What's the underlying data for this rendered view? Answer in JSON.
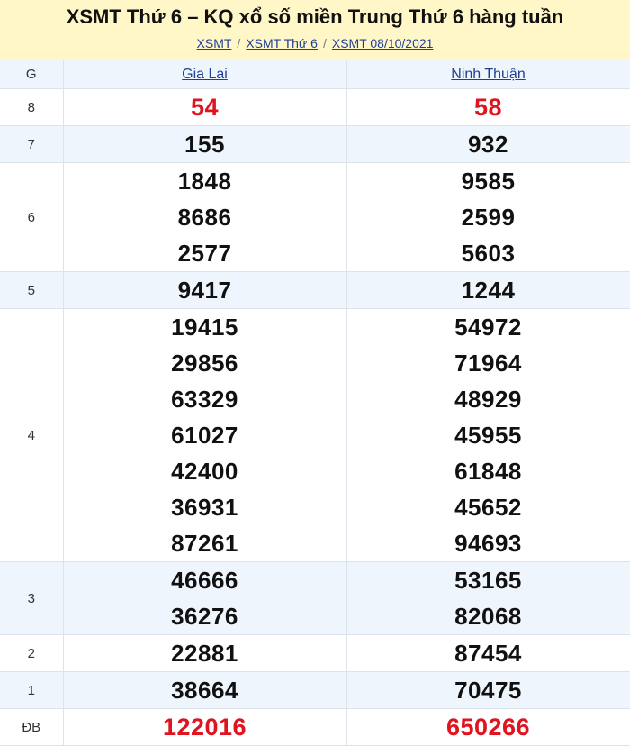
{
  "header": {
    "title": "XSMT Thứ 6 – KQ xổ số miền Trung Thứ 6 hàng tuần",
    "breadcrumb": [
      "XSMT",
      "XSMT Thứ 6",
      "XSMT 08/10/2021"
    ],
    "separator": "/"
  },
  "table": {
    "prize_col_label": "G",
    "provinces": [
      "Gia Lai",
      "Ninh Thuận"
    ],
    "rows": [
      {
        "prize": "8",
        "highlight": true,
        "alt": false,
        "results": [
          [
            "54"
          ],
          [
            "58"
          ]
        ]
      },
      {
        "prize": "7",
        "highlight": false,
        "alt": true,
        "results": [
          [
            "155"
          ],
          [
            "932"
          ]
        ]
      },
      {
        "prize": "6",
        "highlight": false,
        "alt": false,
        "results": [
          [
            "1848",
            "8686",
            "2577"
          ],
          [
            "9585",
            "2599",
            "5603"
          ]
        ]
      },
      {
        "prize": "5",
        "highlight": false,
        "alt": true,
        "results": [
          [
            "9417"
          ],
          [
            "1244"
          ]
        ]
      },
      {
        "prize": "4",
        "highlight": false,
        "alt": false,
        "results": [
          [
            "19415",
            "29856",
            "63329",
            "61027",
            "42400",
            "36931",
            "87261"
          ],
          [
            "54972",
            "71964",
            "48929",
            "45955",
            "61848",
            "45652",
            "94693"
          ]
        ]
      },
      {
        "prize": "3",
        "highlight": false,
        "alt": true,
        "results": [
          [
            "46666",
            "36276"
          ],
          [
            "53165",
            "82068"
          ]
        ]
      },
      {
        "prize": "2",
        "highlight": false,
        "alt": false,
        "results": [
          [
            "22881"
          ],
          [
            "87454"
          ]
        ]
      },
      {
        "prize": "1",
        "highlight": false,
        "alt": true,
        "results": [
          [
            "38664"
          ],
          [
            "70475"
          ]
        ]
      },
      {
        "prize": "ĐB",
        "highlight": true,
        "alt": false,
        "results": [
          [
            "122016"
          ],
          [
            "650266"
          ]
        ]
      }
    ]
  }
}
